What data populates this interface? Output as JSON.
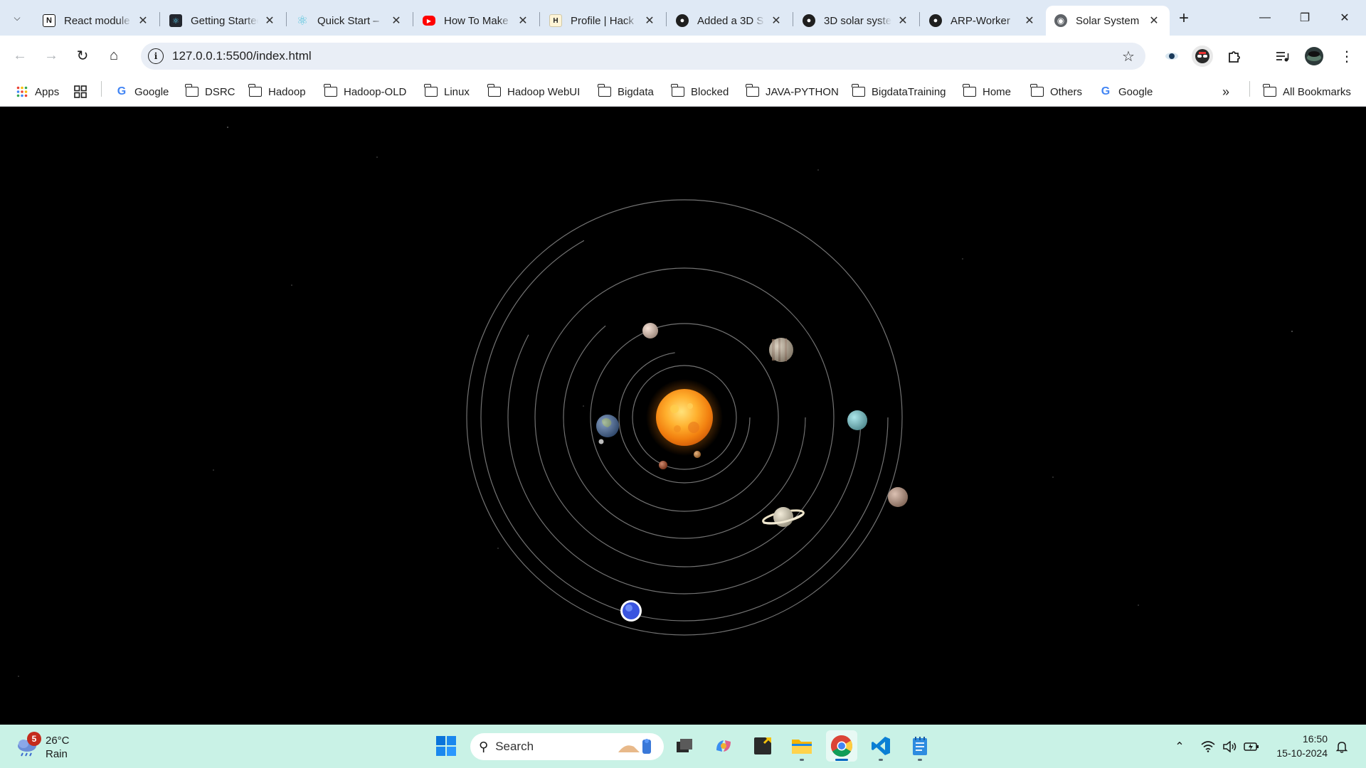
{
  "tabs": [
    {
      "title": "React module",
      "favicon": "notion-icon"
    },
    {
      "title": "Getting Started",
      "favicon": "react-icon"
    },
    {
      "title": "Quick Start –",
      "favicon": "react-icon"
    },
    {
      "title": "How To Make",
      "favicon": "youtube-icon"
    },
    {
      "title": "Profile | Hack",
      "favicon": "hackerrank-icon"
    },
    {
      "title": "Added a 3D S",
      "favicon": "github-icon"
    },
    {
      "title": "3D solar syste",
      "favicon": "github-icon"
    },
    {
      "title": "ARP-Worker",
      "favicon": "github-icon"
    },
    {
      "title": "Solar System",
      "favicon": "globe-icon",
      "active": true
    }
  ],
  "toolbar": {
    "url": "127.0.0.1:5500/index.html"
  },
  "bookmarks": {
    "apps_label": "Apps",
    "items": [
      {
        "label": "Google",
        "type": "google"
      },
      {
        "label": "DSRC",
        "type": "folder"
      },
      {
        "label": "Hadoop",
        "type": "folder"
      },
      {
        "label": "Hadoop-OLD",
        "type": "folder"
      },
      {
        "label": "Linux",
        "type": "folder"
      },
      {
        "label": "Hadoop WebUI",
        "type": "folder"
      },
      {
        "label": "Bigdata",
        "type": "folder"
      },
      {
        "label": "Blocked",
        "type": "folder"
      },
      {
        "label": "JAVA-PYTHON",
        "type": "folder"
      },
      {
        "label": "BigdataTraining",
        "type": "folder"
      },
      {
        "label": "Home",
        "type": "folder"
      },
      {
        "label": "Others",
        "type": "folder"
      },
      {
        "label": "Google",
        "type": "google"
      }
    ],
    "all_bookmarks": "All Bookmarks"
  },
  "scene": {
    "background": "#000000",
    "sun_color": "#f5a623",
    "orbit_color": "#8a8a8a",
    "planets": [
      {
        "name": "mercury",
        "color": "#d9893a"
      },
      {
        "name": "venus",
        "color": "#f2d2c0"
      },
      {
        "name": "earth",
        "color": "#4a6fa5"
      },
      {
        "name": "mars",
        "color": "#b44a22"
      },
      {
        "name": "jupiter",
        "color": "#c8b8a0"
      },
      {
        "name": "saturn",
        "color": "#ece2c6"
      },
      {
        "name": "uranus",
        "color": "#7fd8e0"
      },
      {
        "name": "neptune",
        "color": "#3a55e0"
      },
      {
        "name": "pluto",
        "color": "#c9a08a"
      }
    ]
  },
  "taskbar": {
    "weather_badge": "5",
    "weather_temp": "26°C",
    "weather_condition": "Rain",
    "search_label": "Search",
    "time": "16:50",
    "date": "15-10-2024"
  }
}
